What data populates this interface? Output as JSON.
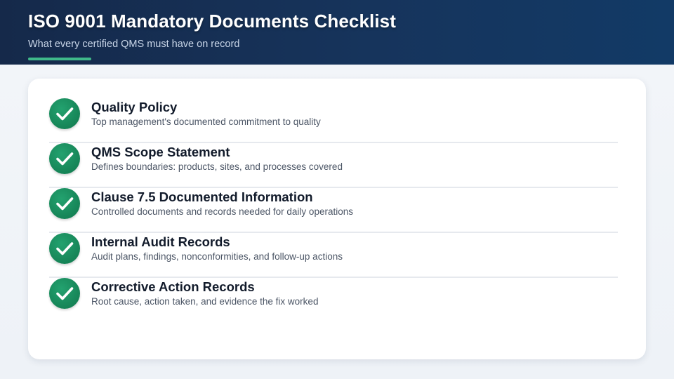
{
  "header": {
    "title": "ISO 9001 Mandatory Documents Checklist",
    "subtitle": "What every certified QMS must have on record"
  },
  "colors": {
    "header_bg": "#15294a",
    "accent": "#3fb98a",
    "check_green": "#168457",
    "card_bg": "#ffffff",
    "page_bg": "#eef2f7"
  },
  "checklist": {
    "items": [
      {
        "icon": "check-circle-icon",
        "title": "Quality Policy",
        "description": "Top management's documented commitment to quality"
      },
      {
        "icon": "check-circle-icon",
        "title": "QMS Scope Statement",
        "description": "Defines boundaries: products, sites, and processes covered"
      },
      {
        "icon": "check-circle-icon",
        "title": "Clause 7.5 Documented Information",
        "description": "Controlled documents and records needed for daily operations"
      },
      {
        "icon": "check-circle-icon",
        "title": "Internal Audit Records",
        "description": "Audit plans, findings, nonconformities, and follow-up actions"
      },
      {
        "icon": "check-circle-icon",
        "title": "Corrective Action Records",
        "description": "Root cause, action taken, and evidence the fix worked"
      }
    ]
  }
}
